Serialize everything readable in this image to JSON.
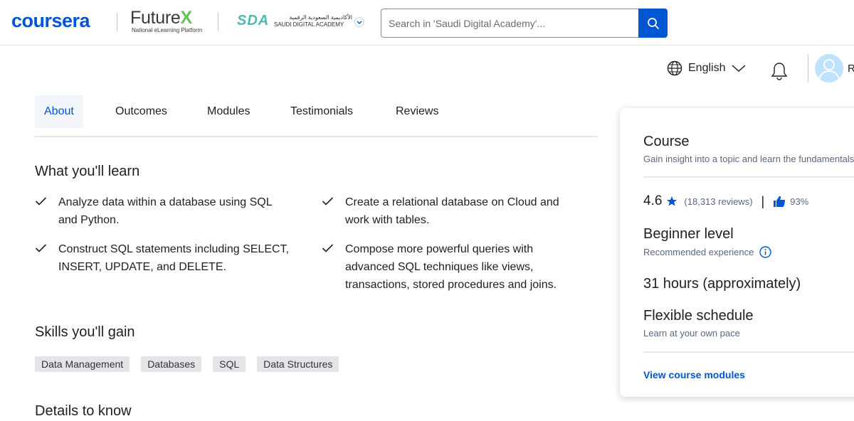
{
  "header": {
    "brand": "coursera",
    "partner1_name": "Future",
    "partner1_x": "X",
    "partner1_sub": "National eLearning Platform",
    "partner2_logo": "SDA",
    "partner2_text_ar": "الأكاديمية السعودية الرقمية",
    "partner2_text_en": "SAUDI DIGITAL ACADEMY",
    "search_placeholder": "Search in 'Saudi Digital Academy'..."
  },
  "subheader": {
    "language": "English",
    "avatar_initial": "R"
  },
  "tabs": [
    {
      "label": "About",
      "active": true
    },
    {
      "label": "Outcomes"
    },
    {
      "label": "Modules"
    },
    {
      "label": "Testimonials"
    },
    {
      "label": "Reviews"
    }
  ],
  "learn": {
    "title": "What you'll learn",
    "items": [
      "Analyze data within a database using SQL and Python.",
      "Create a relational database on Cloud and work with tables.",
      "Construct SQL statements including SELECT, INSERT, UPDATE, and DELETE.",
      "Compose more powerful queries with advanced SQL techniques like views, transactions, stored procedures and joins."
    ]
  },
  "skills": {
    "title": "Skills you'll gain",
    "items": [
      "Data Management",
      "Databases",
      "SQL",
      "Data Structures"
    ]
  },
  "details": {
    "title": "Details to know"
  },
  "card": {
    "type_label": "Course",
    "type_sub": "Gain insight into a topic and learn the fundamentals",
    "rating": "4.6",
    "reviews": "(18,313 reviews)",
    "separator": "|",
    "like_pct": "93%",
    "level": "Beginner level",
    "level_sub": "Recommended experience",
    "hours": "31 hours (approximately)",
    "schedule": "Flexible schedule",
    "schedule_sub": "Learn at your own pace",
    "link": "View course modules"
  },
  "colors": {
    "brand_blue": "#0056d2",
    "tab_active_bg": "#f2f5fa",
    "chip_bg": "#e3e5e9",
    "futurex_green": "#6bbf59",
    "sda_teal": "#52b7b0"
  }
}
